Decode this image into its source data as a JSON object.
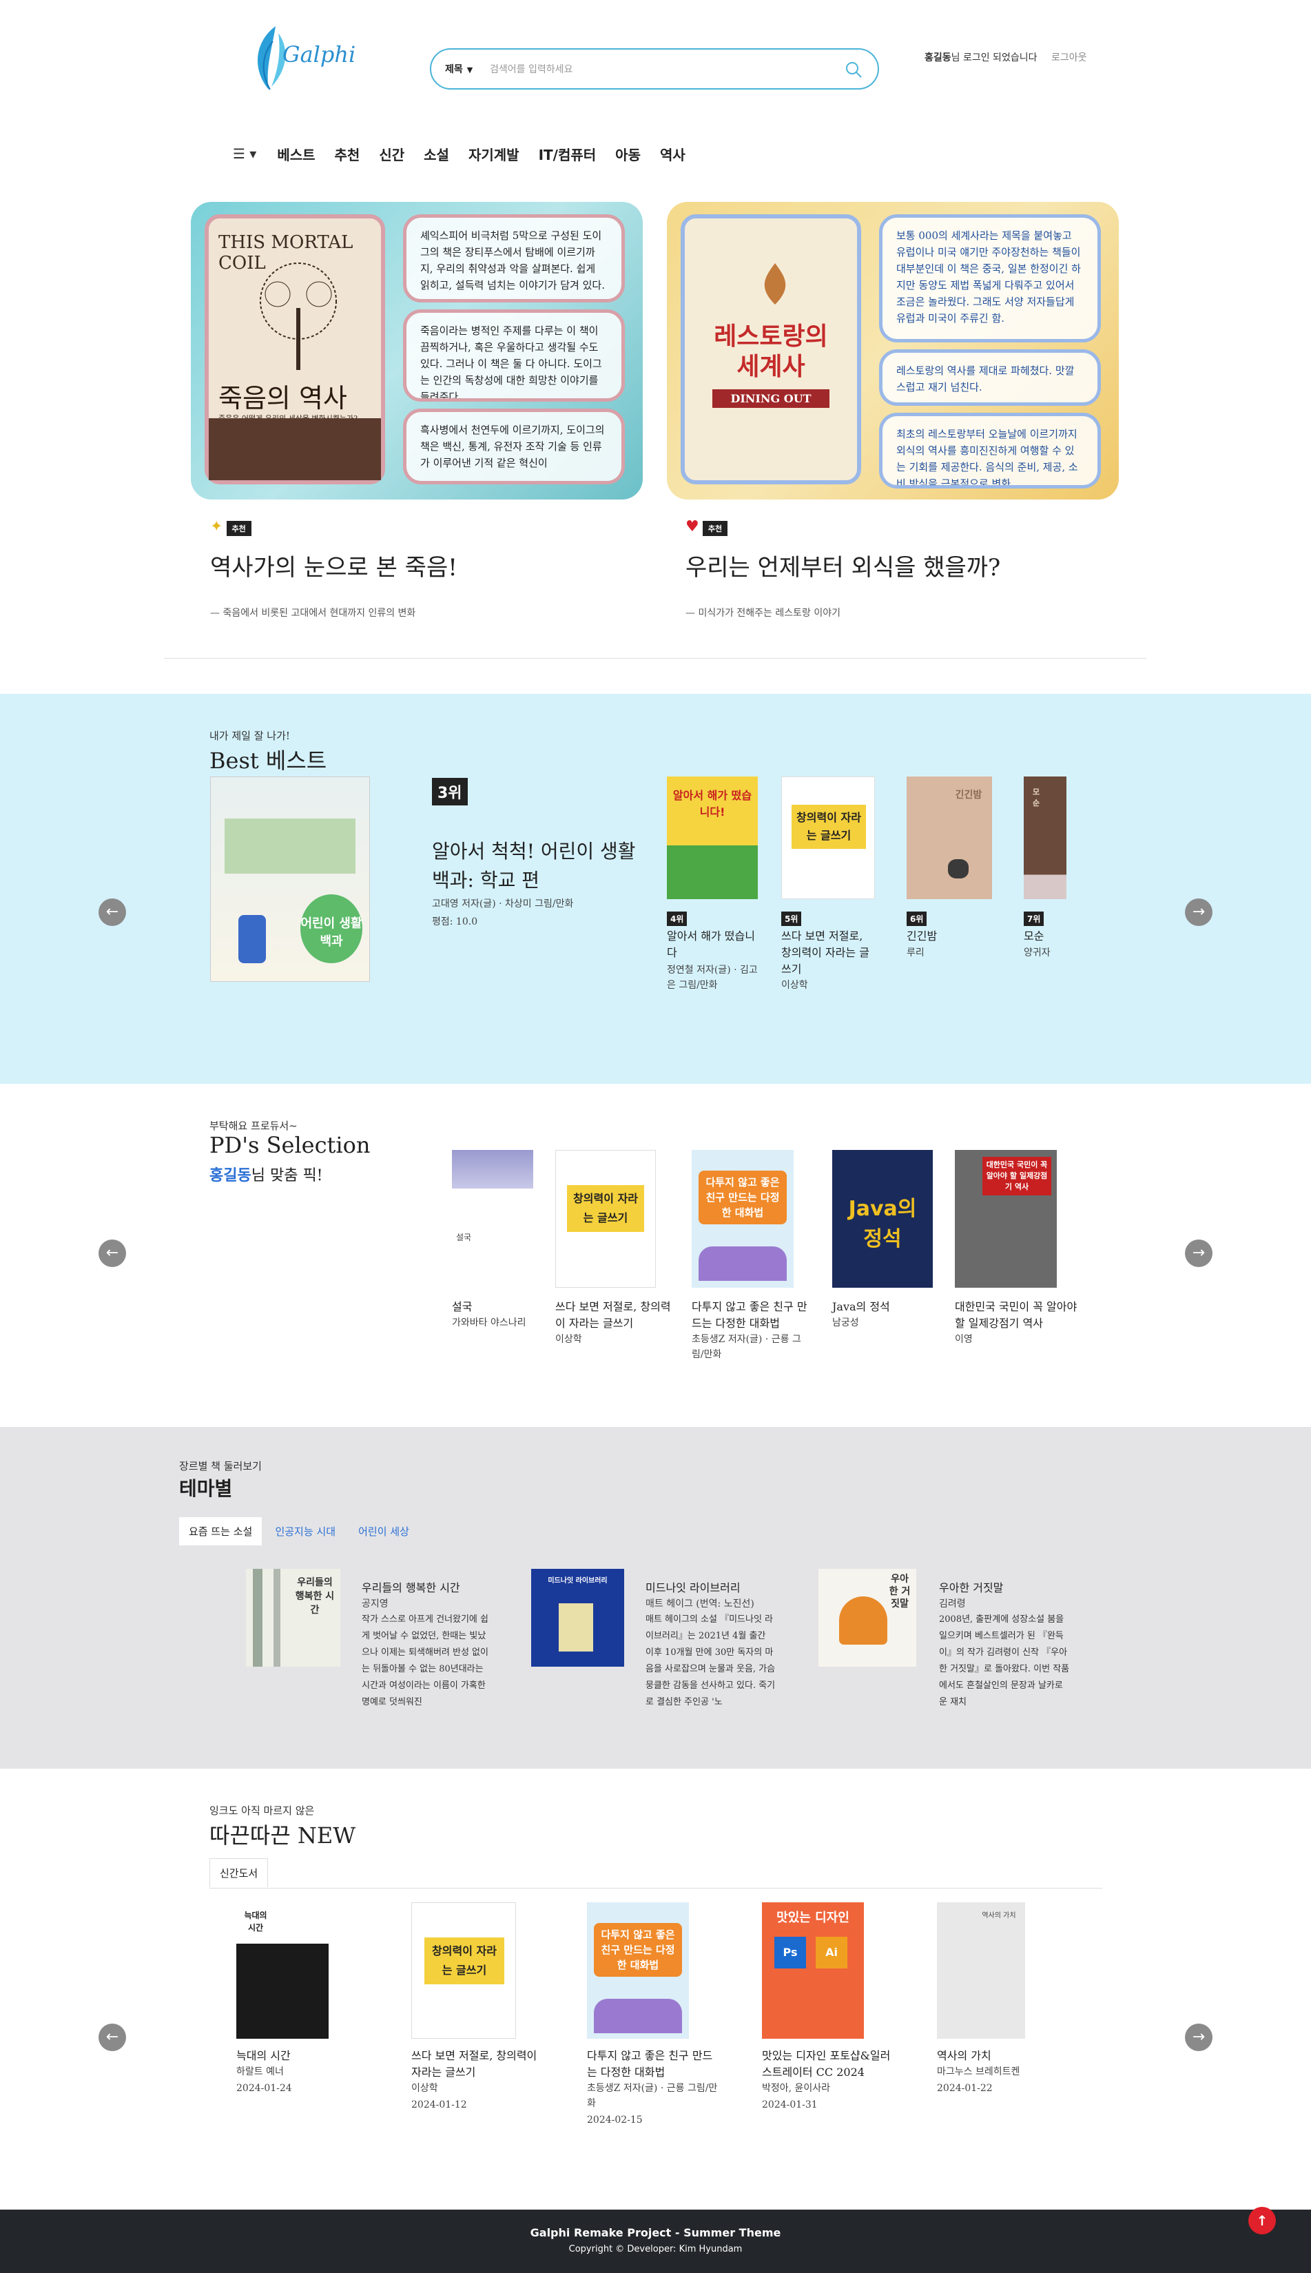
{
  "header": {
    "logo_text": "Galphi",
    "search_select": "제목",
    "search_placeholder": "검색어를 입력하세요",
    "user_name": "홍길동",
    "login_suffix": "님 로그인 되었습니다",
    "logout_label": "로그아웃",
    "menu_icon": "hamburger-icon",
    "nav": [
      "베스트",
      "추천",
      "신간",
      "소설",
      "자기계발",
      "IT/컴퓨터",
      "아동",
      "역사"
    ]
  },
  "hero": [
    {
      "badge": "추천",
      "icon": "sparkle-icon",
      "title": "역사가의 눈으로 본 죽음!",
      "subtitle": "— 죽음에서 비롯된 고대에서 현대까지 인류의 변화",
      "cover_en": "THIS MORTAL COIL",
      "cover_title": "죽음의 역사",
      "cover_sub": "죽음은 어떻게 우리의 세상을 변화시켰는가?",
      "bubbles": [
        "셰익스피어 비극처럼 5막으로 구성된 도이그의 책은 장티푸스에서 탐배에 이르기까지, 우리의 취약성과 악을 살펴본다. 쉽게 읽히고, 설득력 넘치는 이야기가 담겨 있다.",
        "죽음이라는 병적인 주제를 다루는 이 책이 끔찍하거나, 혹은 우울하다고 생각될 수도 있다. 그러나 이 책은 둘 다 아니다. 도이그는 인간의 독창성에 대한 희망찬 이야기를 들려준다.",
        "흑사병에서 천연두에 이르기까지, 도이그의 책은 백신, 통계, 유전자 조작 기술 등 인류가 이루어낸 기적 같은 혁신이"
      ]
    },
    {
      "badge": "추천",
      "icon": "heart-icon",
      "title": "우리는 언제부터 외식을 했을까?",
      "subtitle": "— 미식가가 전해주는 레스토랑 이야기",
      "cover_title": "레스토랑의 세계사",
      "cover_en": "DINING OUT",
      "bubbles": [
        "보통 000의 세계사라는 제목을 붙여놓고 유럽이나 미국 얘기만 주야장천하는 책들이 대부분인데 이 책은 중국, 일본 한정이긴 하지만 동양도 제법 폭넓게 다뤄주고 있어서 조금은 놀라웠다. 그래도 서양 저자들답게 유럽과 미국이 주류긴 함.",
        "레스토랑의 역사를 제대로 파헤쳤다. 맛깔스럽고 재기 넘친다.",
        "최초의 레스토랑부터 오늘날에 이르기까지 외식의 역사를 흥미진진하게 여행할 수 있는 기회를 제공한다. 음식의 준비, 제공, 소비 방식을 근본적으로 변화"
      ]
    }
  ],
  "best": {
    "eyebrow": "내가 제일 잘 나가!",
    "title": "Best 베스트",
    "featured": {
      "rank": "3위",
      "title": "알아서 척척! 어린이 생활백과: 학교 편",
      "author": "고대영 저자(글) · 차상미 그림/만화",
      "rating": "평점: 10.0",
      "cover_text": "어린이 생활백과"
    },
    "items": [
      {
        "rank": "4위",
        "title": "알아서 해가 떴습니다",
        "author": "정연철 저자(글) · 김고은 그림/만화",
        "cover_text": "알아서 해가 떴습니다!"
      },
      {
        "rank": "5위",
        "title": "쓰다 보면 저절로, 창의력이 자라는 글쓰기",
        "author": "이상학",
        "cover_text": "창의력이 자라는 글쓰기"
      },
      {
        "rank": "6위",
        "title": "긴긴밤",
        "author": "루리",
        "cover_text": "긴긴밤"
      },
      {
        "rank": "7위",
        "title": "모순",
        "author": "양귀자",
        "cover_text": "모순"
      }
    ],
    "prev_icon": "arrow-left-icon",
    "next_icon": "arrow-right-icon"
  },
  "pd": {
    "eyebrow": "부탁해요 프로듀서~",
    "title": "PD's Selection",
    "user_name": "홍길동",
    "pick_suffix": "님 맞춤 픽!",
    "items": [
      {
        "title": "설국",
        "author": "가와바타 야스나리",
        "cover_text": "설국"
      },
      {
        "title": "쓰다 보면 저절로, 창의력이 자라는 글쓰기",
        "author": "이상학",
        "cover_text": "창의력이 자라는 글쓰기"
      },
      {
        "title": "다투지 않고 좋은 친구 만드는 다정한 대화법",
        "author": "초등생Z 저자(글) · 근룡 그림/만화",
        "cover_text": "다투지 않고 좋은 친구 만드는 다정한 대화법"
      },
      {
        "title": "Java의 정석",
        "author": "남궁성",
        "cover_text": "Java의 정석"
      },
      {
        "title": "대한민국 국민이 꼭 알아야 할 일제강점기 역사",
        "author": "이영",
        "cover_text": "대한민국 국민이 꼭 알아야 할 일제강점기 역사"
      }
    ]
  },
  "theme": {
    "eyebrow": "장르별 책 둘러보기",
    "title": "테마별",
    "tabs": [
      "요즘 뜨는 소설",
      "인공지능 시대",
      "어린이 세상"
    ],
    "items": [
      {
        "title": "우리들의 행복한 시간",
        "author": "공지영",
        "desc": "작가 스스로 아프게 건너왔기에 쉽게 벗어날 수 없었던, 한때는 빛났으나 이제는 퇴색해버려 반성 없이는 뒤돌아볼 수 없는 80년대라는 시간과 여성이라는 이름이 가혹한 명예로 덧씌워진",
        "cover_text": "우리들의 행복한 시간"
      },
      {
        "title": "미드나잇 라이브러리",
        "author": "매트 헤이그 (번역: 노진선)",
        "desc": "매트 헤이그의 소설 『미드나잇 라이브러리』는 2021년 4월 출간 이후 10개월 만에 30만 독자의 마음을 사로잡으며 눈물과 웃음, 가슴 뭉클한 감동을 선사하고 있다. 죽기로 결심한 주인공 '노",
        "cover_text": "미드나잇 라이브러리"
      },
      {
        "title": "우아한 거짓말",
        "author": "김려령",
        "desc": "2008년, 출판계에 성장소설 붐을 일으키며 베스트셀러가 된 『완득이』의 작가 김려령이 신작 『우아한 거짓말』로 돌아왔다. 이번 작품에서도 흔철살인의 문장과 날카로운 재치",
        "cover_text": "우아한 거짓말"
      }
    ]
  },
  "newbooks": {
    "eyebrow": "잉크도 아직 마르지 않은",
    "title": "따끈따끈 NEW",
    "tab": "신간도서",
    "items": [
      {
        "title": "늑대의 시간",
        "author": "하랄트 예너",
        "date": "2024-01-24",
        "cover_text": "늑대의 시간"
      },
      {
        "title": "쓰다 보면 저절로, 창의력이 자라는 글쓰기",
        "author": "이상학",
        "date": "2024-01-12",
        "cover_text": "창의력이 자라는 글쓰기"
      },
      {
        "title": "다투지 않고 좋은 친구 만드는 다정한 대화법",
        "author": "초등생Z 저자(글) · 근룡 그림/만화",
        "date": "2024-02-15",
        "cover_text": "다투지 않고 좋은 친구 만드는 다정한 대화법"
      },
      {
        "title": "맛있는 디자인 포토샵&일러스트레이터 CC 2024",
        "author": "박정아, 윤이사라",
        "date": "2024-01-31",
        "cover_text": "맛있는 디자인"
      },
      {
        "title": "역사의 가치",
        "author": "마그누스 브레히트켄",
        "date": "2024-01-22",
        "cover_text": "역사의 가치"
      }
    ]
  },
  "footer": {
    "project": "Galphi Remake Project - Summer Theme",
    "copyright": "Copyright © Developer: Kim Hyundam",
    "top_icon": "arrow-up-icon"
  },
  "colors": {
    "accent": "#4ab4d8",
    "best_bg": "#d5f2fb",
    "theme_bg": "#e4e4e6",
    "footer_bg": "#23272b",
    "top_btn": "#e0202a",
    "link": "#2a6fd6"
  }
}
